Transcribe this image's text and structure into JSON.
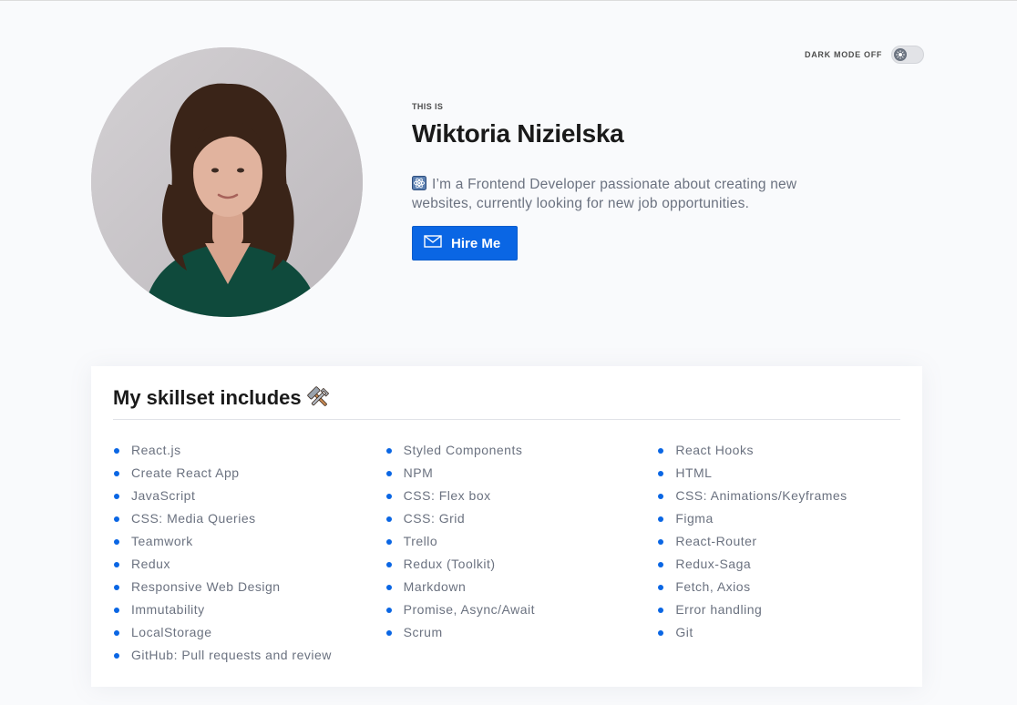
{
  "theme_toggle": {
    "label": "DARK MODE OFF",
    "state": "off",
    "knob_icon": "sun-icon"
  },
  "profile": {
    "photo_alt": "Wiktoria Nizielska portrait",
    "eyebrow": "THIS IS",
    "name": "Wiktoria Nizielska",
    "bio_icon": "atom-icon",
    "bio": "I’m a Frontend Developer passionate about creating new websites, currently looking for new job opportunities.",
    "hire_button": {
      "label": "Hire Me",
      "icon": "mail-icon"
    }
  },
  "skills": {
    "title": "My skillset includes",
    "title_icon": "hammer-wrench-icon",
    "items": [
      "React.js",
      "Styled Components",
      "React Hooks",
      "Create React App",
      "NPM",
      "HTML",
      "JavaScript",
      "CSS: Flex box",
      "CSS: Animations/Keyframes",
      "CSS: Media Queries",
      "CSS: Grid",
      "Figma",
      "Teamwork",
      "Trello",
      "React-Router",
      "Redux",
      "Redux (Toolkit)",
      "Redux-Saga",
      "Responsive Web Design",
      "Markdown",
      "Fetch, Axios",
      "Immutability",
      "Promise, Async/Await",
      "Error handling",
      "LocalStorage",
      "Scrum",
      "Git",
      "GitHub: Pull requests and review"
    ]
  },
  "colors": {
    "accent": "#0a66e4",
    "background": "#f9fafc",
    "card": "#ffffff",
    "heading": "#1a1a1a",
    "body_text": "#6b7280"
  }
}
